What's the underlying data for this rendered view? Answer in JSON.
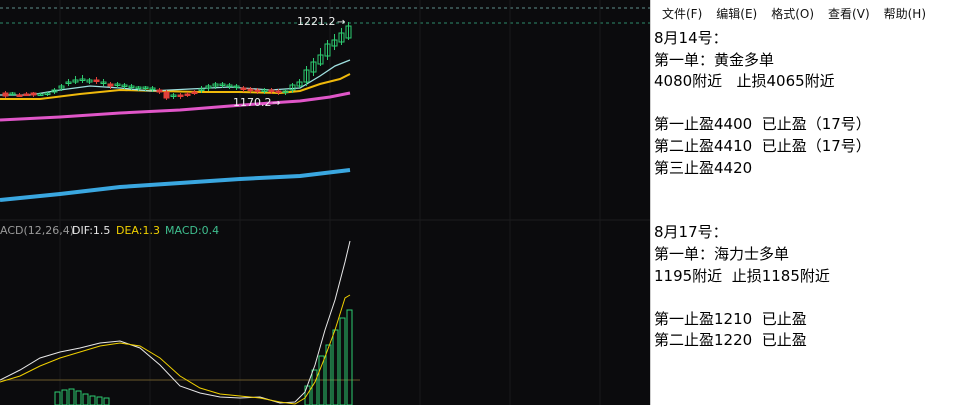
{
  "chart": {
    "price_high_label": "1221.2",
    "price_low_label": "1170.2",
    "macd": {
      "label": "ACD(12,26,4)",
      "dif": "DIF:1.5",
      "dea": "DEA:1.3",
      "macd": "MACD:0.4"
    },
    "colors": {
      "background": "#0b0b0d",
      "up": "#2ecc71",
      "down": "#e0403a",
      "ma_short": "#e8e8e8",
      "ma_mid": "#f0b90b",
      "ma_long": "#e056c8",
      "ma_longer": "#3aa7e0"
    }
  },
  "notepad": {
    "menu": [
      "文件(F)",
      "编辑(E)",
      "格式(O)",
      "查看(V)",
      "帮助(H)"
    ],
    "lines": [
      "8月14号：",
      "第一单：黄金多单",
      "4080附近   止损4065附近",
      "",
      "第一止盈4400  已止盈（17号）",
      "第二止盈4410  已止盈（17号）",
      "第三止盈4420",
      "",
      "",
      "8月17号：",
      "第一单：海力士多单",
      "1195附近  止损1185附近",
      "",
      "第一止盈1210  已止盈",
      "第二止盈1220  已止盈"
    ]
  }
}
